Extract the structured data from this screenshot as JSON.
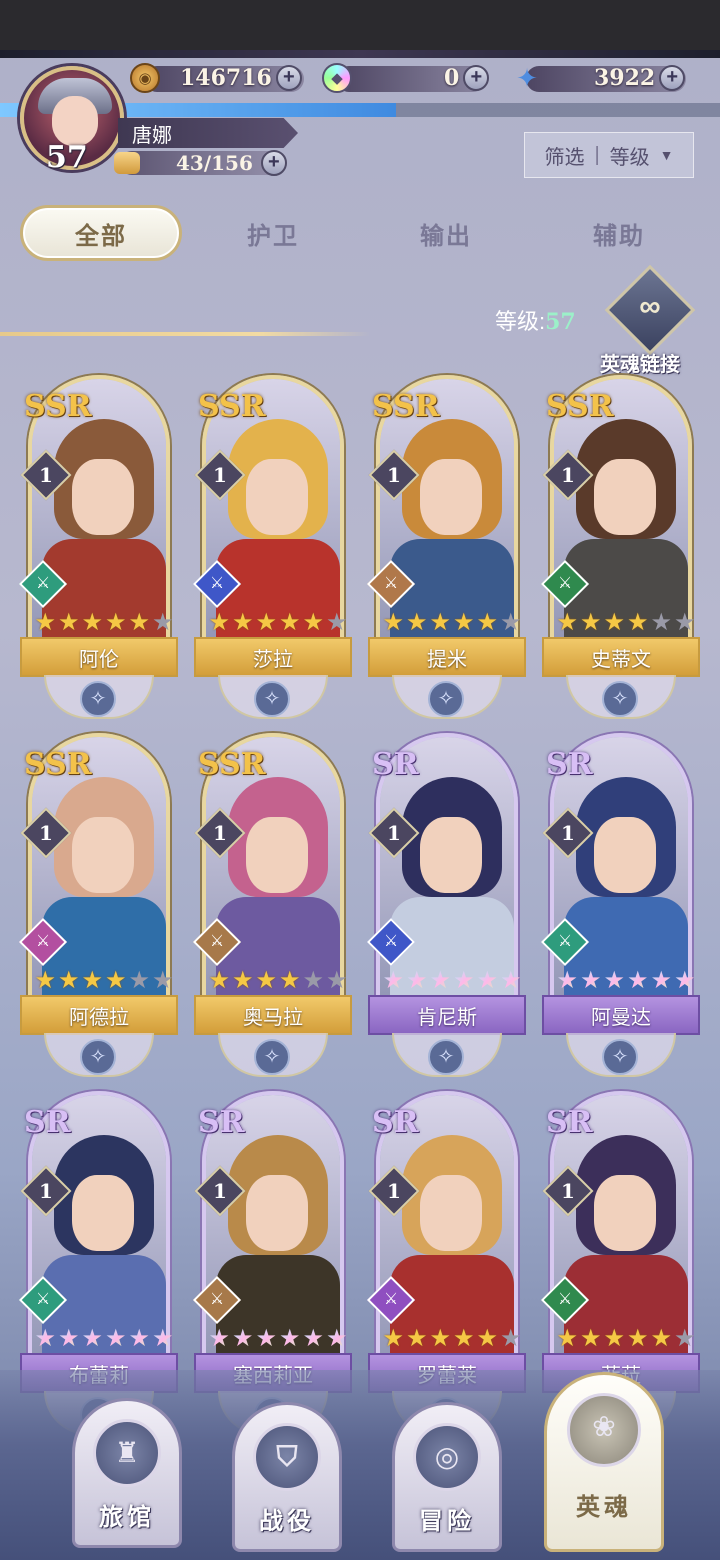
{
  "currencies": [
    {
      "icon": "gold-coin-icon",
      "value": "146716"
    },
    {
      "icon": "rainbow-gem-icon",
      "value": "0"
    },
    {
      "icon": "blue-star-icon",
      "value": "3922"
    }
  ],
  "player": {
    "name": "唐娜",
    "level": "57",
    "stamina": "43/156",
    "exp_fraction": 0.55
  },
  "filter": {
    "label": "筛选",
    "value": "等级"
  },
  "tabs": [
    {
      "label": "全部",
      "active": true
    },
    {
      "label": "护卫",
      "active": false
    },
    {
      "label": "输出",
      "active": false
    },
    {
      "label": "辅助",
      "active": false
    }
  ],
  "level_filter": {
    "label": "等级:",
    "value": "57"
  },
  "soul_link": {
    "label": "英魂链接"
  },
  "heroes": [
    {
      "name": "阿伦",
      "rank": "SSR",
      "level": "1",
      "stars": 5,
      "star_style": "gold",
      "role_color": "#2e9c7d",
      "hair": "#8a5a3a",
      "body": "#a33a2e"
    },
    {
      "name": "莎拉",
      "rank": "SSR",
      "level": "1",
      "stars": 5,
      "star_style": "gold",
      "role_color": "#3f57c8",
      "hair": "#e3b24c",
      "body": "#b8332c"
    },
    {
      "name": "提米",
      "rank": "SSR",
      "level": "1",
      "stars": 5,
      "star_style": "gold",
      "role_color": "#b0784a",
      "hair": "#c98a3a",
      "body": "#3b5a8c"
    },
    {
      "name": "史蒂文",
      "rank": "SSR",
      "level": "1",
      "stars": 4,
      "star_style": "gold",
      "role_color": "#2f8a4e",
      "hair": "#5a3a2a",
      "body": "#4c4a48"
    },
    {
      "name": "阿德拉",
      "rank": "SSR",
      "level": "1",
      "stars": 4,
      "star_style": "gold",
      "role_color": "#b34fa0",
      "hair": "#d9a98e",
      "body": "#2f6ea8"
    },
    {
      "name": "奥马拉",
      "rank": "SSR",
      "level": "1",
      "stars": 4,
      "star_style": "gold",
      "role_color": "#a7794a",
      "hair": "#c4628e",
      "body": "#6d5aa0"
    },
    {
      "name": "肯尼斯",
      "rank": "SR",
      "level": "1",
      "stars": 6,
      "star_style": "rainbow",
      "role_color": "#3f57c8",
      "hair": "#2e2f5e",
      "body": "#c4cde0"
    },
    {
      "name": "阿曼达",
      "rank": "SR",
      "level": "1",
      "stars": 6,
      "star_style": "rainbow",
      "role_color": "#2e9c7d",
      "hair": "#303f7a",
      "body": "#3f6ab2"
    },
    {
      "name": "布蕾莉",
      "rank": "SR",
      "level": "1",
      "stars": 6,
      "star_style": "rainbow",
      "role_color": "#2e9c7d",
      "hair": "#2c3560",
      "body": "#5a6eb0"
    },
    {
      "name": "塞西莉亚",
      "rank": "SR",
      "level": "1",
      "stars": 6,
      "star_style": "rainbow",
      "role_color": "#a7794a",
      "hair": "#b98a4a",
      "body": "#3d3528"
    },
    {
      "name": "罗蕾莱",
      "rank": "SR",
      "level": "1",
      "stars": 5,
      "star_style": "gold",
      "role_color": "#8f4fc0",
      "hair": "#d7a45a",
      "body": "#a8302e"
    },
    {
      "name": "菲菈",
      "rank": "SR",
      "level": "1",
      "stars": 5,
      "star_style": "gold",
      "role_color": "#2f8a4e",
      "hair": "#3c2f5a",
      "body": "#9c2e35"
    }
  ],
  "nav": [
    {
      "label": "旅馆",
      "icon": "tavern-icon",
      "active": false
    },
    {
      "label": "战役",
      "icon": "campaign-icon",
      "active": false
    },
    {
      "label": "冒险",
      "icon": "adventure-icon",
      "active": false
    },
    {
      "label": "英魂",
      "icon": "hero-soul-icon",
      "active": true
    }
  ]
}
